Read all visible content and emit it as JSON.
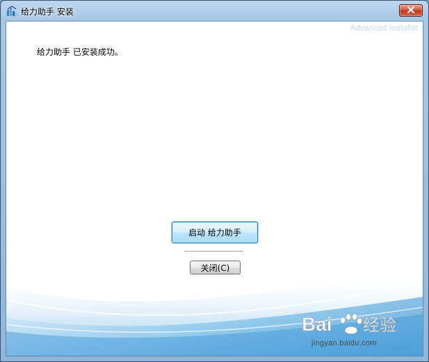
{
  "window": {
    "title": "给力助手 安装",
    "icon": "installer-icon",
    "close_icon": "close-icon"
  },
  "header": {
    "brand": "Advanced Installer"
  },
  "main": {
    "message": "给力助手 已安装成功。",
    "launch_button": "启动 给力助手",
    "close_button": "关闭(C)"
  },
  "watermark": {
    "logo_text": "Bai 经验",
    "url": "jingyan.baidu.com"
  },
  "colors": {
    "title_gradient_top": "#bcd6ee",
    "close_red": "#c1341c",
    "wave_blue": "#4f9fd8",
    "launch_button_border": "#3c7fb1"
  }
}
